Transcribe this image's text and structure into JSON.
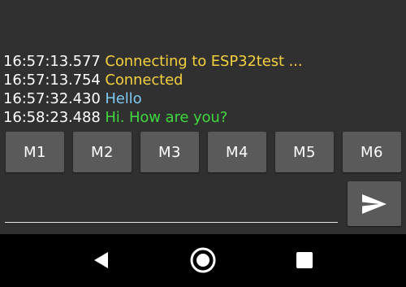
{
  "terminal": {
    "lines": [
      {
        "time": "16:57:13.577",
        "message": "Connecting to ESP32test ...",
        "color": "#f4d03f"
      },
      {
        "time": "16:57:13.754",
        "message": "Connected",
        "color": "#f4d03f"
      },
      {
        "time": "16:57:32.430",
        "message": "Hello",
        "color": "#7ec8f0"
      },
      {
        "time": "16:58:23.488",
        "message": "Hi. How are you?",
        "color": "#3fd83f"
      }
    ]
  },
  "macros": [
    {
      "label": "M1"
    },
    {
      "label": "M2"
    },
    {
      "label": "M3"
    },
    {
      "label": "M4"
    },
    {
      "label": "M5"
    },
    {
      "label": "M6"
    }
  ],
  "input": {
    "value": "",
    "placeholder": ""
  },
  "send": {
    "icon": "send-icon"
  },
  "navbar": {
    "back_icon": "back-icon",
    "home_icon": "home-icon",
    "recents_icon": "recents-icon"
  },
  "colors": {
    "background": "#303030",
    "button": "#5a5a5a",
    "navbar": "#000000"
  }
}
